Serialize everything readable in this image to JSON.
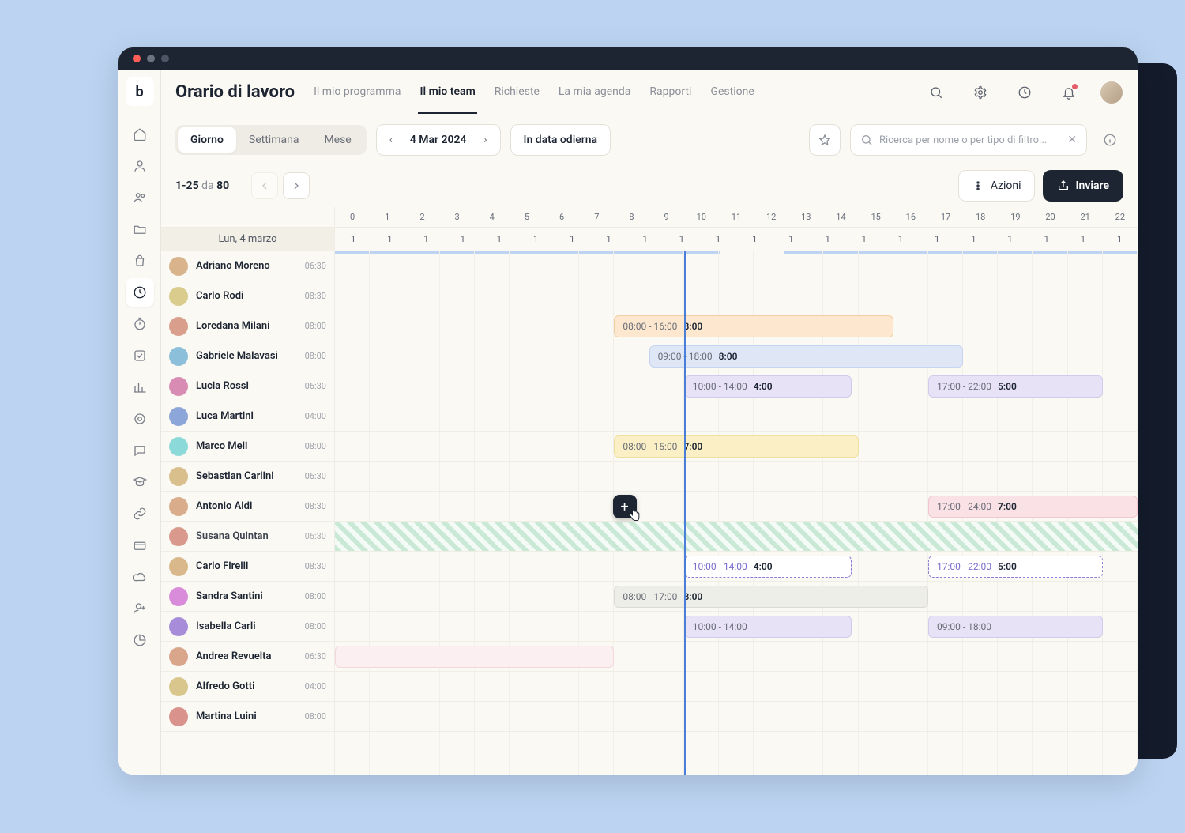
{
  "header": {
    "title": "Orario di lavoro",
    "tabs": [
      {
        "label": "Il mio programma",
        "active": false
      },
      {
        "label": "Il mio team",
        "active": true
      },
      {
        "label": "Richieste",
        "active": false
      },
      {
        "label": "La mia agenda",
        "active": false
      },
      {
        "label": "Rapporti",
        "active": false
      },
      {
        "label": "Gestione",
        "active": false
      }
    ]
  },
  "toolbar": {
    "segments": [
      {
        "label": "Giorno",
        "active": true
      },
      {
        "label": "Settimana",
        "active": false
      },
      {
        "label": "Mese",
        "active": false
      }
    ],
    "date": "4 Mar 2024",
    "today": "In data odierna",
    "search_placeholder": "Ricerca per nome o per tipo di filtro..."
  },
  "actionbar": {
    "range_from": "1-25",
    "range_sep": "da",
    "range_total": "80",
    "actions_label": "Azioni",
    "send_label": "Inviare"
  },
  "schedule": {
    "date_header": "Lun, 4 marzo",
    "hours": [
      "0",
      "1",
      "2",
      "3",
      "4",
      "5",
      "6",
      "7",
      "8",
      "9",
      "10",
      "11",
      "12",
      "13",
      "14",
      "15",
      "16",
      "17",
      "18",
      "19",
      "20",
      "21",
      "22"
    ],
    "counts": [
      "1",
      "1",
      "1",
      "1",
      "1",
      "1",
      "1",
      "1",
      "1",
      "1",
      "1",
      "1",
      "1",
      "1",
      "1",
      "1",
      "1",
      "1",
      "1",
      "1",
      "1",
      "1"
    ],
    "count_strips": [
      {
        "left": 0.0,
        "width": 0.48
      },
      {
        "left": 0.56,
        "width": 0.44
      }
    ],
    "now_hour": 10.0,
    "people": [
      {
        "name": "Adriano Moreno",
        "time": "06:30",
        "avatar_hue": 30
      },
      {
        "name": "Carlo Rodi",
        "time": "08:30",
        "avatar_hue": 50
      },
      {
        "name": "Loredana Milani",
        "time": "08:00",
        "avatar_hue": 15
      },
      {
        "name": "Gabriele Malavasi",
        "time": "08:00",
        "avatar_hue": 200
      },
      {
        "name": "Lucia Rossi",
        "time": "06:30",
        "avatar_hue": 330
      },
      {
        "name": "Luca Martini",
        "time": "04:00",
        "avatar_hue": 220
      },
      {
        "name": "Marco Meli",
        "time": "08:00",
        "avatar_hue": 180
      },
      {
        "name": "Sebastian Carlini",
        "time": "06:30",
        "avatar_hue": 40
      },
      {
        "name": "Antonio Aldi",
        "time": "08:30",
        "avatar_hue": 25
      },
      {
        "name": "Susana Quintan",
        "time": "06:30",
        "avatar_hue": 10,
        "hatched": true
      },
      {
        "name": "Carlo Firelli",
        "time": "08:30",
        "avatar_hue": 35
      },
      {
        "name": "Sandra Santini",
        "time": "08:00",
        "avatar_hue": 300
      },
      {
        "name": "Isabella Carli",
        "time": "08:00",
        "avatar_hue": 260
      },
      {
        "name": "Andrea Revuelta",
        "time": "06:30",
        "avatar_hue": 20
      },
      {
        "name": "Alfredo Gotti",
        "time": "04:00",
        "avatar_hue": 45
      },
      {
        "name": "Martina Luini",
        "time": "08:00",
        "avatar_hue": 5
      }
    ],
    "shifts": [
      {
        "row": 2,
        "start": 8,
        "end": 16,
        "style": "orange",
        "label_time": "08:00 - 16:00",
        "label_dur": "8:00"
      },
      {
        "row": 3,
        "start": 9,
        "end": 18,
        "style": "blue",
        "label_time": "09:00 - 18:00",
        "label_dur": "8:00"
      },
      {
        "row": 4,
        "start": 10,
        "end": 14.8,
        "style": "purple",
        "label_time": "10:00 - 14:00",
        "label_dur": "4:00"
      },
      {
        "row": 4,
        "start": 17,
        "end": 22,
        "style": "purple",
        "label_time": "17:00 - 22:00",
        "label_dur": "5:00"
      },
      {
        "row": 6,
        "start": 8,
        "end": 15,
        "style": "yellow",
        "label_time": "08:00 - 15:00",
        "label_dur": "7:00"
      },
      {
        "row": 8,
        "start": 17,
        "end": 23,
        "style": "pink",
        "label_time": "17:00 - 24:00",
        "label_dur": "7:00"
      },
      {
        "row": 10,
        "start": 10,
        "end": 14.8,
        "style": "dashed-purple",
        "label_time": "10:00 - 14:00",
        "label_dur": "4:00"
      },
      {
        "row": 10,
        "start": 17,
        "end": 22,
        "style": "dashed-purple",
        "label_time": "17:00 - 22:00",
        "label_dur": "5:00"
      },
      {
        "row": 11,
        "start": 8,
        "end": 17,
        "style": "grey",
        "label_time": "08:00 - 17:00",
        "label_dur": "8:00"
      },
      {
        "row": 12,
        "start": 10,
        "end": 14.8,
        "style": "purple",
        "label_time": "10:00 - 14:00",
        "label_dur": ""
      },
      {
        "row": 12,
        "start": 17,
        "end": 22,
        "style": "purple",
        "label_time": "09:00 - 18:00",
        "label_dur": ""
      },
      {
        "row": 13,
        "start": 0,
        "end": 8,
        "style": "pink-soft",
        "label_time": "",
        "label_dur": ""
      }
    ],
    "add_button_row": 8,
    "add_button_hour": 8.3
  }
}
